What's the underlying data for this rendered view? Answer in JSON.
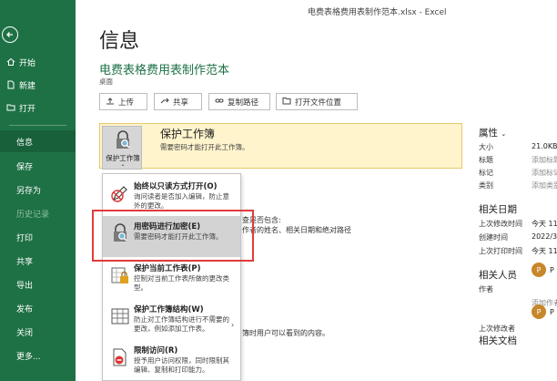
{
  "window_title": "电费表格费用表制作范本.xlsx - Excel",
  "sidebar": {
    "items": [
      {
        "label": "开始",
        "icon": "home-icon"
      },
      {
        "label": "新建",
        "icon": "new-file-icon"
      },
      {
        "label": "打开",
        "icon": "folder-open-icon"
      },
      {
        "label": "信息"
      },
      {
        "label": "保存"
      },
      {
        "label": "另存为"
      },
      {
        "label": "历史记录"
      },
      {
        "label": "打印"
      },
      {
        "label": "共享"
      },
      {
        "label": "导出"
      },
      {
        "label": "发布"
      },
      {
        "label": "关闭"
      },
      {
        "label": "更多..."
      }
    ]
  },
  "page": {
    "title": "信息",
    "doc_name": "电费表格费用表制作范本",
    "doc_location": "桌面"
  },
  "toolbar": {
    "upload": "上传",
    "share": "共享",
    "copy_path": "复制路径",
    "open_location": "打开文件位置"
  },
  "protect": {
    "button_label": "保护工作簿",
    "title": "保护工作簿",
    "desc": "需要密码才能打开此工作簿。"
  },
  "menu": {
    "items": [
      {
        "title": "始终以只读方式打开(O)",
        "desc": "询问读者是否加入编辑，防止意外的更改。"
      },
      {
        "title": "用密码进行加密(E)",
        "desc": "需要密码才能打开此工作簿。"
      },
      {
        "title": "保护当前工作表(P)",
        "desc": "控制对当前工作表所做的更改类型。"
      },
      {
        "title": "保护工作簿结构(W)",
        "desc": "防止对工作簿结构进行不需要的更改，例如添加工作表。"
      },
      {
        "title": "限制访问(R)",
        "desc": "授予用户访问权限，同时限制其编辑、复制和打印能力。"
      }
    ]
  },
  "background_text": {
    "inspect_line1": "查是否包含:",
    "inspect_line2": "作者的姓名、相关日期和绝对路径",
    "versions_line": "簿时用户可以看到的内容。"
  },
  "properties": {
    "header": "属性",
    "rows": [
      {
        "key": "大小",
        "value": "21.0KB"
      },
      {
        "key": "标题",
        "value": "添加标题"
      },
      {
        "key": "标记",
        "value": "添加标记"
      },
      {
        "key": "类别",
        "value": "添加类别"
      }
    ]
  },
  "dates": {
    "header": "相关日期",
    "rows": [
      {
        "key": "上次修改时间",
        "value": "今天 11:"
      },
      {
        "key": "创建时间",
        "value": "2022/3,"
      },
      {
        "key": "上次打印时间",
        "value": "今天 11:"
      }
    ]
  },
  "people": {
    "header": "相关人员",
    "author_key": "作者",
    "author_initial": "P",
    "author_name": "P",
    "add_author": "添加作者",
    "last_modified_key": "上次修改者",
    "modifier_initial": "P",
    "modifier_name": "P"
  },
  "related_docs": {
    "header": "相关文档"
  },
  "colors": {
    "sidebar": "#1e7145",
    "accent": "#1e7145",
    "highlight_frame": "#e23b3b",
    "protect_bg": "#fff4cc"
  }
}
